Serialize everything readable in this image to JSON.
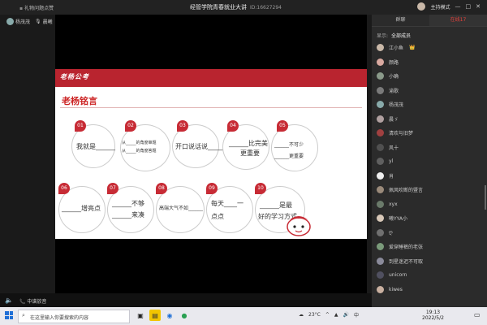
{
  "window": {
    "top_left_label": "礼物问题点赞",
    "title": "经管学院青春就业大讲",
    "meeting_id": "ID:16627294",
    "host_mode": "主持模式",
    "controls": [
      "—",
      "□",
      "✕"
    ]
  },
  "participants": [
    {
      "name": "杨茂茂"
    },
    {
      "name": "晨曦"
    }
  ],
  "slide": {
    "banner": "老杨公考",
    "title": "老杨铭言",
    "items": [
      {
        "num": "01",
        "lines": [
          "我就是______"
        ]
      },
      {
        "num": "02",
        "lines": [
          "从_____的角度审题",
          "从_____的角度答题"
        ]
      },
      {
        "num": "03",
        "lines": [
          "开口说话说______"
        ]
      },
      {
        "num": "04",
        "lines": [
          "______比完美",
          "更重要"
        ]
      },
      {
        "num": "05",
        "lines": [
          "______不可少",
          "______更重要"
        ]
      },
      {
        "num": "06",
        "lines": [
          "______增亮点"
        ]
      },
      {
        "num": "07",
        "lines": [
          "______不够",
          "______来凑"
        ]
      },
      {
        "num": "08",
        "lines": [
          "高端大气不如______"
        ]
      },
      {
        "num": "09",
        "lines": [
          "每天____一",
          "点点"
        ]
      },
      {
        "num": "10",
        "lines": [
          "______是最",
          "好的学习方式"
        ]
      }
    ]
  },
  "sidebar": {
    "tabs": [
      "群聊",
      "在线17"
    ],
    "filter_label": "显示:",
    "filter_value": "全部成员",
    "members": [
      {
        "name": "江小鱼",
        "badge": "👑",
        "color": "#c9b8a8"
      },
      {
        "name": "颜路",
        "color": "#d9a9a0"
      },
      {
        "name": "小确",
        "color": "#8a9a8a"
      },
      {
        "name": "渝歌",
        "color": "#7a7a7a"
      },
      {
        "name": "杨茂茂",
        "color": "#8aa"
      },
      {
        "name": "晨ゞ",
        "color": "#b0a0a0"
      },
      {
        "name": "清欢与旧梦",
        "color": "#a04040"
      },
      {
        "name": "风十",
        "color": "#505050"
      },
      {
        "name": "yl",
        "color": "#606060"
      },
      {
        "name": "肖",
        "color": "#eeeeee"
      },
      {
        "name": "佩风吹断的暨言",
        "color": "#9a8a7a"
      },
      {
        "name": "xyx",
        "color": "#6a7a6a"
      },
      {
        "name": "曦YYA小",
        "color": "#d8c8b8"
      },
      {
        "name": "ღ",
        "color": "#707070"
      },
      {
        "name": "爱穿睡裤的老张",
        "color": "#7a9a7a"
      },
      {
        "name": "到星迷迟不可取",
        "color": "#8a8a9a"
      },
      {
        "name": "unicorn",
        "color": "#505060"
      },
      {
        "name": "kiwes",
        "color": "#c9b0a0"
      }
    ]
  },
  "bottom": {
    "volume_icon": "🔈",
    "language": "中谱放音"
  },
  "taskbar": {
    "search_placeholder": "在这里输入你要搜索的内容",
    "weather": "23°C",
    "time": "19:13",
    "date": "2022/5/2"
  }
}
